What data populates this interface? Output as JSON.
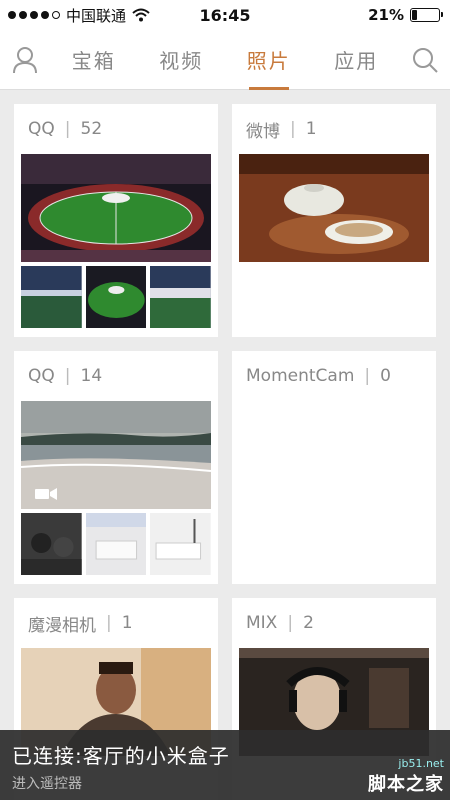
{
  "status_bar": {
    "carrier": "中国联通",
    "time": "16:45",
    "battery_text": "21%",
    "battery_level": 0.21
  },
  "nav": {
    "tabs": [
      {
        "label": "宝箱",
        "active": false
      },
      {
        "label": "视频",
        "active": false
      },
      {
        "label": "照片",
        "active": true
      },
      {
        "label": "应用",
        "active": false
      }
    ],
    "accent_color": "#c87a3c"
  },
  "albums": [
    {
      "name": "QQ",
      "count": "52",
      "has_thumbs": true
    },
    {
      "name": "微博",
      "count": "1",
      "has_thumbs": false
    },
    {
      "name": "QQ",
      "count": "14",
      "has_thumbs": true,
      "video_badge": true
    },
    {
      "name": "MomentCam",
      "count": "0",
      "has_thumbs": false
    },
    {
      "name": "魔漫相机",
      "count": "1",
      "has_thumbs": false
    },
    {
      "name": "MIX",
      "count": "2",
      "has_thumbs": false
    }
  ],
  "toast": {
    "title": "已连接:客厅的小米盒子",
    "subtitle": "进入遥控器"
  },
  "watermark": {
    "line1": "jb51.net",
    "line2": "脚本之家"
  }
}
